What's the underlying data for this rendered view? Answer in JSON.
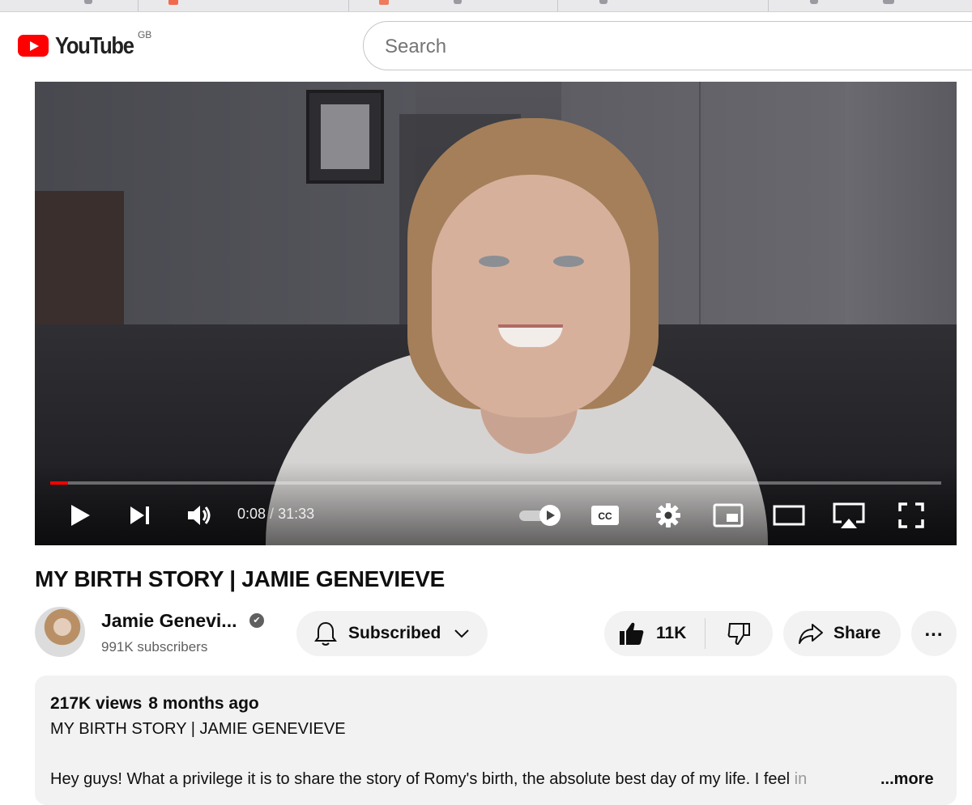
{
  "masthead": {
    "logo_text": "YouTube",
    "country_code": "GB",
    "search_placeholder": "Search"
  },
  "player": {
    "current_time": "0:08",
    "separator": " / ",
    "duration": "31:33",
    "played_fraction": 0.004,
    "buffered_fraction": 0.02,
    "autoplay": "on",
    "accent_color": "#ff0000"
  },
  "video": {
    "title": "MY BIRTH STORY | JAMIE GENEVIEVE"
  },
  "channel": {
    "name": "Jamie Genevi...",
    "subscribers": "991K subscribers",
    "subscribe_label": "Subscribed"
  },
  "actions": {
    "likes": "11K",
    "share_label": "Share",
    "more_label": "..."
  },
  "description": {
    "views": "217K views",
    "age": "8 months ago",
    "title_line": "MY BIRTH STORY | JAMIE GENEVIEVE",
    "body": "Hey guys! What a privilege it is to share the story of Romy's birth, the absolute best day of my life. I feel ",
    "body_faded": "in",
    "more_label": "...more"
  },
  "icons": [
    "youtube-logo-icon",
    "play-icon",
    "next-icon",
    "volume-icon",
    "autoplay-toggle-icon",
    "captions-icon",
    "settings-icon",
    "miniplayer-icon",
    "theater-icon",
    "airplay-icon",
    "fullscreen-icon",
    "bell-icon",
    "chevron-down-icon",
    "thumbs-up-icon",
    "thumbs-down-icon",
    "share-icon",
    "verified-icon"
  ]
}
